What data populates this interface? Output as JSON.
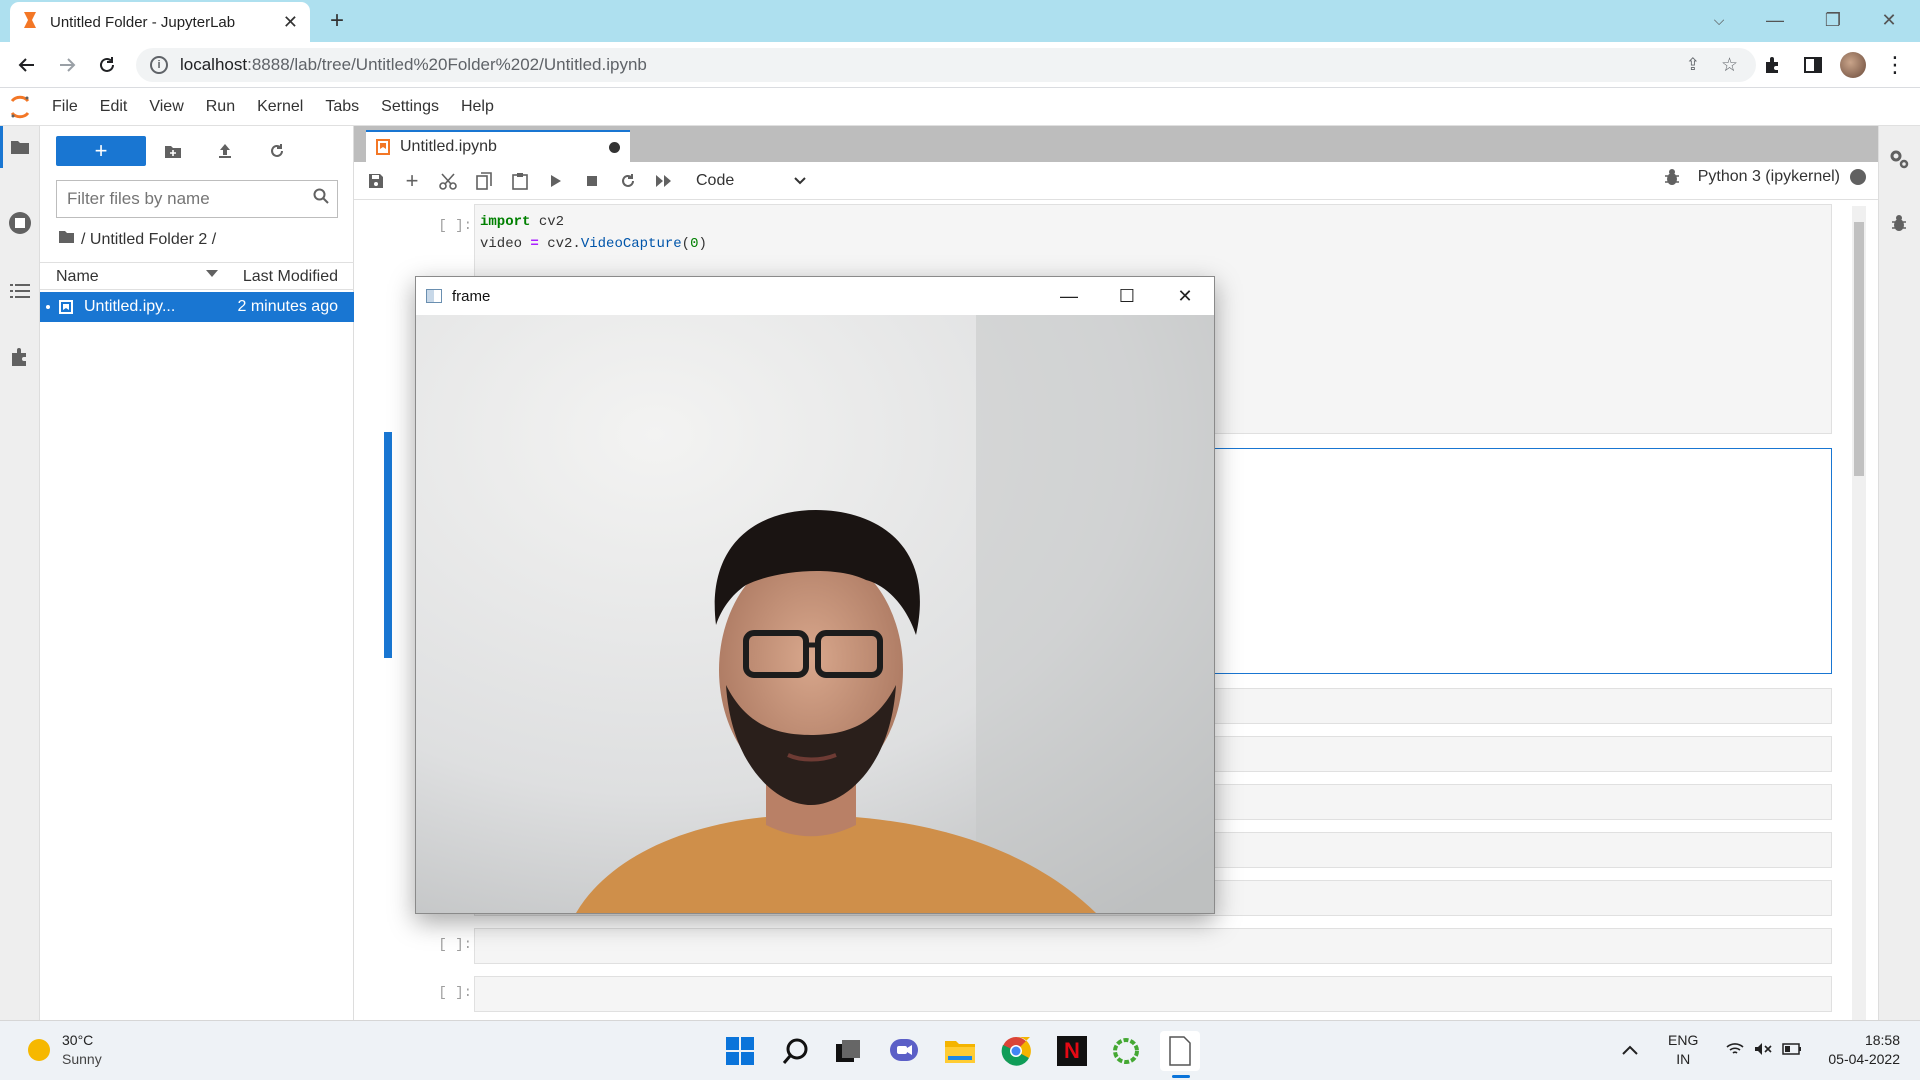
{
  "browser": {
    "tab_title": "Untitled Folder - JupyterLab",
    "url_host": "localhost",
    "url_rest": ":8888/lab/tree/Untitled%20Folder%202/Untitled.ipynb"
  },
  "menubar": [
    "File",
    "Edit",
    "View",
    "Run",
    "Kernel",
    "Tabs",
    "Settings",
    "Help"
  ],
  "filebrowser": {
    "filter_placeholder": "Filter files by name",
    "breadcrumb": "/ Untitled Folder 2 /",
    "col_name": "Name",
    "col_modified": "Last Modified",
    "file_name": "Untitled.ipy...",
    "file_modified": "2 minutes ago"
  },
  "notebook": {
    "tab_title": "Untitled.ipynb",
    "cell_type": "Code",
    "kernel": "Python 3 (ipykernel)",
    "prompt": "[ ]:",
    "code_line1_kw": "import",
    "code_line1_rest": " cv2",
    "code_line2_a": "video ",
    "code_line2_eq": "=",
    "code_line2_b": " cv2.",
    "code_line2_fn": "VideoCapture",
    "code_line2_c": "(",
    "code_line2_num": "0",
    "code_line2_d": ")"
  },
  "cv_window": {
    "title": "frame"
  },
  "taskbar": {
    "temperature": "30°C",
    "condition": "Sunny",
    "lang_line1": "ENG",
    "lang_line2": "IN",
    "time": "18:58",
    "date": "05-04-2022"
  },
  "colors": {
    "accent": "#1976d2",
    "chrome_tabbar": "#aee0ef"
  }
}
